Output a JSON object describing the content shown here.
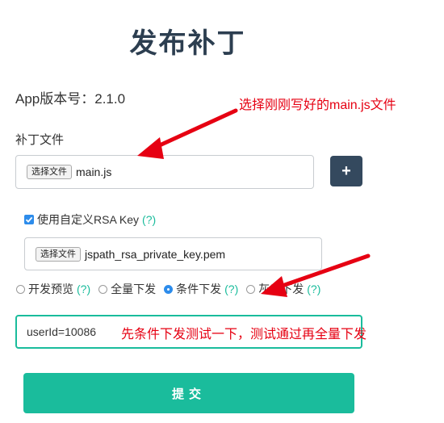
{
  "page": {
    "title": "发布补丁"
  },
  "app": {
    "version_label": "App版本号：2.1.0"
  },
  "patch_file": {
    "label": "补丁文件",
    "choose_button": "选择文件",
    "file_name": "main.js",
    "add_button": "+"
  },
  "rsa": {
    "checked": true,
    "label": "使用自定义RSA Key",
    "help": "(?)",
    "choose_button": "选择文件",
    "file_name": "jspath_rsa_private_key.pem"
  },
  "release_modes": [
    {
      "label": "开发预览",
      "help": "(?)",
      "selected": false
    },
    {
      "label": "全量下发",
      "help": "",
      "selected": false
    },
    {
      "label": "条件下发",
      "help": "(?)",
      "selected": true
    },
    {
      "label": "灰度下发",
      "help": "(?)",
      "selected": false
    }
  ],
  "condition": {
    "value": "userId=10086"
  },
  "submit": {
    "label": "提交"
  },
  "annotations": {
    "note_1": "选择刚刚写好的main.js文件",
    "note_2": "先条件下发测试一下，测试通过再全量下发",
    "color": "#e60012"
  },
  "colors": {
    "accent": "#1abc9c",
    "dark_button": "#34495e",
    "title": "#2c3e50",
    "radio_checked": "#2d8ceb"
  }
}
